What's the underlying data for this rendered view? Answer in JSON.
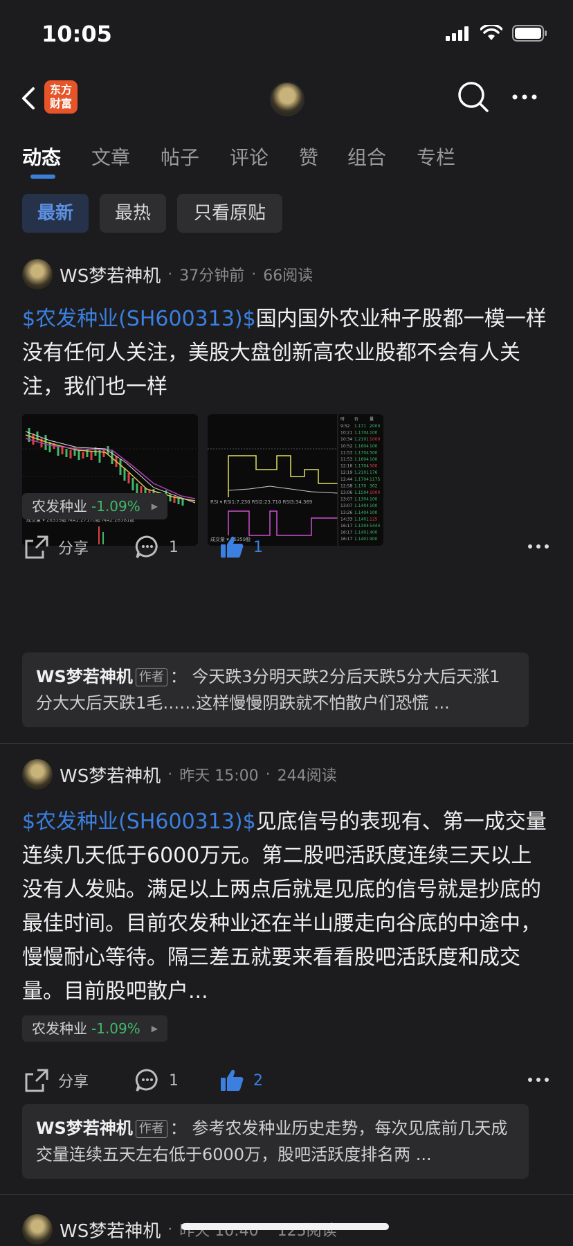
{
  "status_bar": {
    "time": "10:05"
  },
  "nav": {
    "logo_line1": "东方",
    "logo_line2": "财富"
  },
  "tabs": [
    "动态",
    "文章",
    "帖子",
    "评论",
    "赞",
    "组合",
    "专栏"
  ],
  "filters": [
    "最新",
    "最热",
    "只看原贴"
  ],
  "posts": [
    {
      "author": "WS梦若神机",
      "time": "37分钟前",
      "reads": "66阅读",
      "stock_link": "$农发种业(SH600313)$",
      "text": "国内国外农业种子股都一模一样没有任何人关注，美股大盘创新高农业股都不会有人关注，我们也一样",
      "tag_name": "农发种业",
      "tag_change": "-1.09%",
      "share_label": "分享",
      "comment_count": "1",
      "like_count": "1",
      "comment_author": "WS梦若神机",
      "comment_badge": "作者",
      "comment_text": "今天跌3分明天跌2分后天跌5分大后天涨1分大大后天跌1毛……这样慢慢阴跌就不怕散户们恐慌 ..."
    },
    {
      "author": "WS梦若神机",
      "time": "昨天 15:00",
      "reads": "244阅读",
      "stock_link": "$农发种业(SH600313)$",
      "text": "见底信号的表现有、第一成交量连续几天低于6000万元。第二股吧活跃度连续三天以上没有人发贴。满足以上两点后就是见底的信号就是抄底的最佳时间。目前农发种业还在半山腰走向谷底的中途中，慢慢耐心等待。隔三差五就要来看看股吧活跃度和成交量。目前股吧散户...",
      "tag_name": "农发种业",
      "tag_change": "-1.09%",
      "share_label": "分享",
      "comment_count": "1",
      "like_count": "2",
      "comment_author": "WS梦若神机",
      "comment_badge": "作者",
      "comment_text": "参考农发种业历史走势，每次见底前几天成交量连续五天左右低于6000万，股吧活跃度排名两 ..."
    },
    {
      "author": "WS梦若神机",
      "time": "昨天 10:40",
      "reads": "125阅读"
    }
  ],
  "thumb1": {
    "legend": "成交量 ▾  26359股  MA1:27170股  MA2:28581股",
    "legend_color_ma2": "#d05ad0"
  },
  "thumb2": {
    "header": [
      "时",
      "价",
      "量"
    ],
    "rows": [
      [
        "9:52",
        "1.171",
        "2000"
      ],
      [
        "10:21",
        "1.1704",
        "100"
      ],
      [
        "10:34",
        "1.2101",
        "1000"
      ],
      [
        "10:52",
        "1.1604",
        "100"
      ],
      [
        "11:53",
        "1.1704",
        "500"
      ],
      [
        "11:53",
        "1.1604",
        "100"
      ],
      [
        "12:16",
        "1.1704",
        "500"
      ],
      [
        "12:19",
        "1.2101",
        "176"
      ],
      [
        "12:44",
        "1.1704",
        "1175"
      ],
      [
        "12:58",
        "1.170",
        "302"
      ],
      [
        "13:06",
        "1.1504",
        "1000"
      ],
      [
        "13:07",
        "1.1304",
        "100"
      ],
      [
        "13:07",
        "1.1404",
        "100"
      ],
      [
        "13:26",
        "1.1404",
        "100"
      ],
      [
        "14:33",
        "1.1401",
        "125"
      ],
      [
        "16:17",
        "1.1304",
        "5444"
      ],
      [
        "16:17",
        "1.1401",
        "400"
      ],
      [
        "16:17",
        "1.1401",
        "900"
      ]
    ],
    "rsi": "RSI ▾  RSI1:7.230  RSI2:23.710  RSI3:34.369",
    "vol": "成交量 ▾  26359股"
  }
}
